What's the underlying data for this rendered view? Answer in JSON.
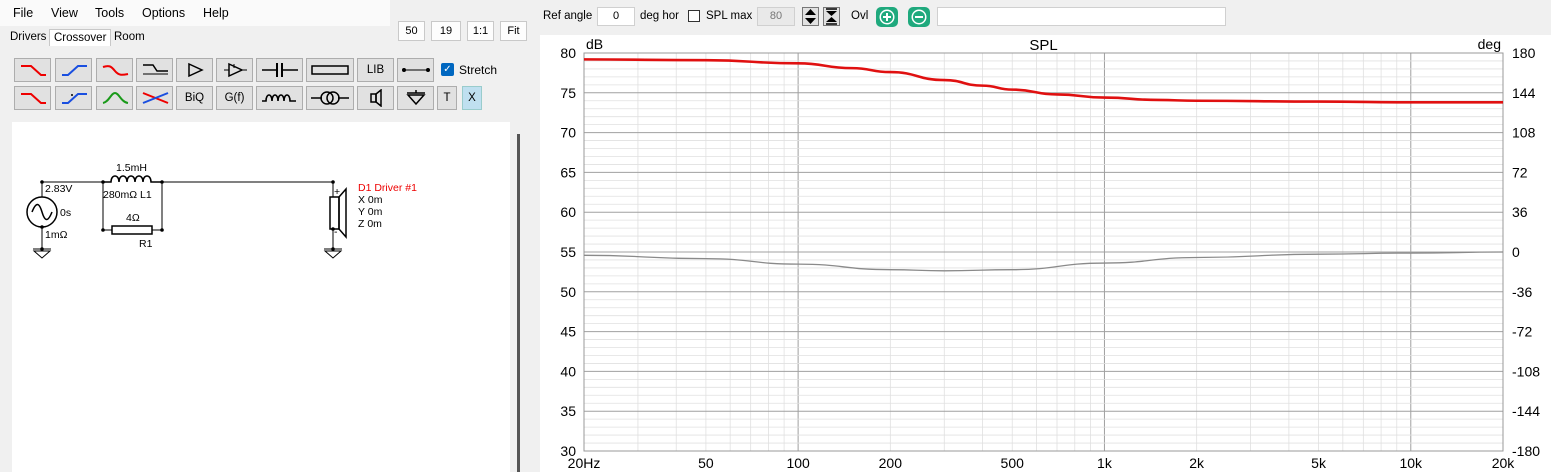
{
  "menu": [
    "File",
    "View",
    "Tools",
    "Options",
    "Help"
  ],
  "tabs": [
    "Drivers",
    "Crossover",
    "Room"
  ],
  "view_buttons": [
    "50",
    "19",
    "1:1",
    "Fit"
  ],
  "toolbar": {
    "lib_label": "LIB",
    "biq_label": "BiQ",
    "gf_label": "G(f)",
    "t_label": "T",
    "x_label": "X",
    "stretch_label": "Stretch",
    "stretch_checked": true,
    "icons": [
      "lowpass-red-icon",
      "highpass-blue-icon",
      "bandpass-red-icon",
      "shelf-icon",
      "amplifier-icon",
      "opamp-icon",
      "capacitor-icon",
      "resistor-icon",
      "wire-icon",
      "lowpass-red-2-icon",
      "highpass-blue-2-icon",
      "bandpass-green-icon",
      "crossover-icon",
      "inductor-icon",
      "transformer-icon",
      "speaker-icon",
      "ground-icon"
    ]
  },
  "schematic": {
    "source_voltage": "2.83V",
    "source_delay": "0s",
    "source_resistance": "1mΩ",
    "inductor_value": "1.5mH",
    "inductor_label": "280mΩ L1",
    "resistor_value": "4Ω",
    "resistor_name": "R1",
    "driver_name": "D1 Driver #1",
    "driver_x": "X 0m",
    "driver_y": "Y 0m",
    "driver_z": "Z 0m",
    "plus": "+",
    "minus": "-"
  },
  "controls": {
    "ref_angle_label": "Ref angle",
    "ref_angle_value": "0",
    "deg_hor_label": "deg hor",
    "spl_max_label": "SPL max",
    "spl_max_checked": false,
    "spl_max_value": "80",
    "ovl_label": "Ovl",
    "search_value": ""
  },
  "chart_data": {
    "type": "line",
    "title": "SPL",
    "ylabel_left": "dB",
    "ylabel_right": "deg",
    "xscale": "log",
    "xlim": [
      20,
      20000
    ],
    "ylim": [
      30,
      80
    ],
    "y2lim": [
      -180,
      180
    ],
    "x_ticks": [
      "20Hz",
      "50",
      "100",
      "200",
      "500",
      "1k",
      "2k",
      "5k",
      "10k",
      "20k"
    ],
    "y_ticks": [
      "80",
      "75",
      "70",
      "65",
      "60",
      "55",
      "50",
      "45",
      "40",
      "35",
      "30"
    ],
    "y2_ticks": [
      "180",
      "144",
      "108",
      "72",
      "36",
      "0",
      "-36",
      "-72",
      "-108",
      "-144",
      "-180"
    ],
    "grid": true,
    "colors": {
      "spl": "#e01010",
      "phase": "#8a8a8a",
      "grid_major": "#a0a0a0",
      "grid_minor": "#e0e0e0"
    },
    "series": [
      {
        "axis": "left",
        "x": [
          20,
          50,
          100,
          150,
          200,
          300,
          400,
          500,
          700,
          1000,
          1500,
          2000,
          5000,
          10000,
          20000
        ],
        "y": [
          79.2,
          79.1,
          78.7,
          78.1,
          77.6,
          76.6,
          75.9,
          75.4,
          74.8,
          74.4,
          74.1,
          74.0,
          73.9,
          73.8,
          73.8
        ]
      },
      {
        "axis": "right",
        "x": [
          20,
          50,
          100,
          200,
          300,
          500,
          1000,
          2000,
          5000,
          10000,
          20000
        ],
        "y": [
          -3,
          -6,
          -11,
          -16,
          -17,
          -16,
          -10,
          -5,
          -2,
          -1,
          0
        ]
      }
    ]
  }
}
